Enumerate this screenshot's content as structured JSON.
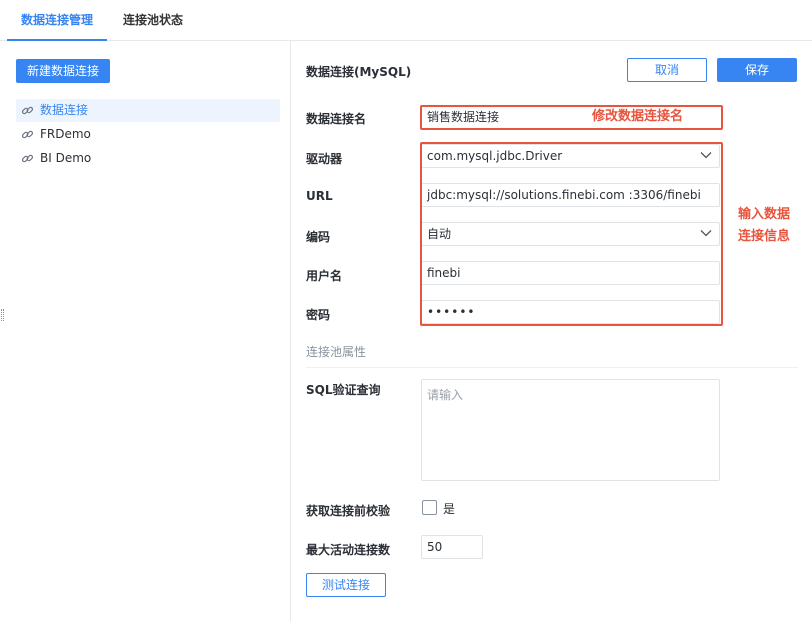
{
  "tabs": [
    {
      "label": "数据连接管理",
      "active": true
    },
    {
      "label": "连接池状态",
      "active": false
    }
  ],
  "sidebar": {
    "new_button": "新建数据连接",
    "items": [
      {
        "label": "数据连接",
        "selected": true,
        "icon": "link-icon"
      },
      {
        "label": "FRDemo",
        "selected": false,
        "icon": "link-icon"
      },
      {
        "label": "BI Demo",
        "selected": false,
        "icon": "link-icon"
      }
    ]
  },
  "panel": {
    "title": "数据连接(MySQL)",
    "cancel": "取消",
    "save": "保存"
  },
  "form": {
    "name_label": "数据连接名",
    "name_value": "销售数据连接",
    "driver_label": "驱动器",
    "driver_value": "com.mysql.jdbc.Driver",
    "url_label": "URL",
    "url_value": "jdbc:mysql://solutions.finebi.com :3306/finebi",
    "encoding_label": "编码",
    "encoding_value": "自动",
    "user_label": "用户名",
    "user_value": "finebi",
    "password_label": "密码",
    "password_value": "••••••",
    "pool_section": "连接池属性",
    "sql_label": "SQL验证查询",
    "sql_placeholder": "请输入",
    "validate_label": "获取连接前校验",
    "validate_option": "是",
    "validate_checked": false,
    "max_active_label": "最大活动连接数",
    "max_active_value": "50",
    "test_button": "测试连接"
  },
  "annotations": {
    "rename_hint": "修改数据连接名",
    "info_hint_line1": "输入数据",
    "info_hint_line2": "连接信息",
    "color": "#e8553f"
  },
  "colors": {
    "accent": "#3685f2",
    "selected_bg": "#eef4fd"
  }
}
